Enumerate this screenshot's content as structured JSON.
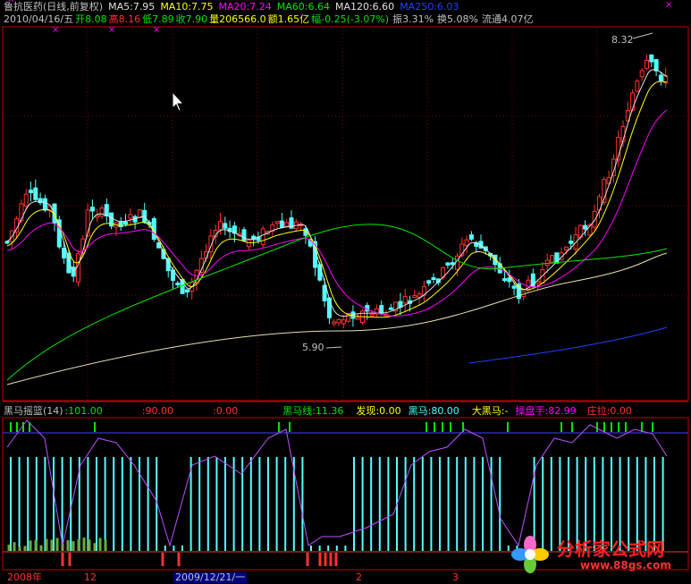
{
  "colors": {
    "red": "#ff3232",
    "green": "#00e600",
    "cyan": "#54ffff",
    "yellow": "#ffff00",
    "white": "#e0e0e0",
    "magenta": "#ff00ff",
    "blue": "#2040ff",
    "grid": "#800000",
    "border": "#c00000"
  },
  "header": {
    "title": "鲁抗医药(日线,前复权)",
    "ma5": "MA5:7.95",
    "ma10": "MA10:7.75",
    "ma20": "MA20:7.24",
    "ma60": "MA60:6.64",
    "ma120": "MA120:6.60",
    "ma250": "MA250:6.03"
  },
  "quote": {
    "date": "2010/04/16/五",
    "open": "开8.08",
    "high": "高8.16",
    "low": "低7.89",
    "close": "收7.90",
    "volume": "量206566.0",
    "amount": "额1.65亿",
    "change": "幅-0.25(-3.07%)",
    "amplitude": "振3.31%",
    "turnover": "换5.08%",
    "float": "流通4.07亿"
  },
  "price_marks": {
    "high_label": "8.32",
    "low_label": "5.90"
  },
  "indicator": {
    "name": "黑马摇篮(14)",
    "v1": ":101.00",
    "v2": ":90.00",
    "v3": ":0.00",
    "heima_line": "黑马线:11.36",
    "faxian": "发现:0.00",
    "heima": "黑马:80.00",
    "da_heima": "大黑马:-",
    "caopanshou": "操盘手:82.99",
    "zhuangla": "庄拉:0.00"
  },
  "time_axis": {
    "labels": [
      "2008年",
      "12",
      "2009/12/21/一",
      "2",
      "3"
    ]
  },
  "logo": {
    "name": "分析家公式网",
    "url": "www.88gs.com"
  }
}
